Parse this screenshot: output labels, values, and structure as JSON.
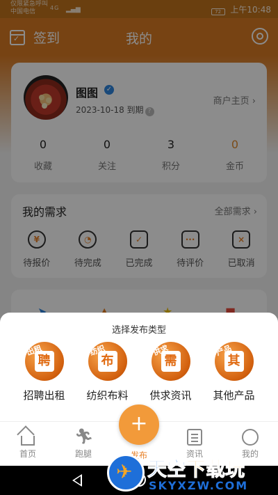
{
  "status_bar": {
    "carrier_line1": "仅限紧急呼叫",
    "carrier_line2": "中国电信",
    "network": "4G",
    "battery": "72",
    "time": "上午10:48"
  },
  "header": {
    "checkin_label": "签到",
    "title": "我的"
  },
  "profile": {
    "nickname": "图图",
    "expire_text": "2023-10-18 到期",
    "shop_link": "商户主页 ›",
    "stats": [
      {
        "value": "0",
        "label": "收藏"
      },
      {
        "value": "0",
        "label": "关注"
      },
      {
        "value": "3",
        "label": "积分"
      },
      {
        "value": "0",
        "label": "金币"
      }
    ]
  },
  "demand": {
    "title": "我的需求",
    "all_link": "全部需求 ›",
    "items": [
      {
        "label": "待报价",
        "icon": "yen-icon"
      },
      {
        "label": "待完成",
        "icon": "clock-icon"
      },
      {
        "label": "已完成",
        "icon": "clipboard-check-icon"
      },
      {
        "label": "待评价",
        "icon": "comment-icon"
      },
      {
        "label": "已取消",
        "icon": "clipboard-x-icon"
      }
    ]
  },
  "sheet": {
    "title": "选择发布类型",
    "types": [
      {
        "label": "招聘出租",
        "char": "聘",
        "edge": "出租"
      },
      {
        "label": "纺织布料",
        "char": "布",
        "edge": "纺织"
      },
      {
        "label": "供求资讯",
        "char": "需",
        "edge": "供求"
      },
      {
        "label": "其他产品",
        "char": "其",
        "edge": "产品"
      }
    ]
  },
  "tabbar": {
    "home": "首页",
    "run": "跑腿",
    "publish": "发布",
    "news": "资讯",
    "mine": "我的"
  },
  "watermark": {
    "big_a": "天空",
    "big_b": "下载玩",
    "small": "SKYXZW.COM"
  },
  "colors": {
    "brand": "#d97b24",
    "accent": "#f29a3a",
    "coin": "#e08a2c"
  }
}
